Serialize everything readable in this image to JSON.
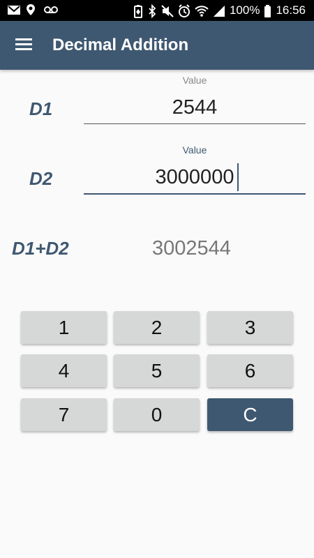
{
  "status_bar": {
    "battery_percent": "100%",
    "time": "16:56",
    "left_icons": [
      "gmail-icon",
      "location-icon",
      "voicemail-icon"
    ],
    "right_icons": [
      "battery-saver-icon",
      "bluetooth-icon",
      "mute-icon",
      "alarm-icon",
      "wifi-icon",
      "signal-icon",
      "battery-icon"
    ]
  },
  "app_bar": {
    "title": "Decimal Addition",
    "color": "#3f5871"
  },
  "form": {
    "d1": {
      "label": "D1",
      "field_label": "Value",
      "value": "2544"
    },
    "d2": {
      "label": "D2",
      "field_label": "Value",
      "value": "3000000"
    },
    "sum": {
      "label": "D1+D2",
      "value": "3002544"
    }
  },
  "keypad": {
    "k1": "1",
    "k2": "2",
    "k3": "3",
    "k4": "4",
    "k5": "5",
    "k6": "6",
    "k7": "7",
    "k0": "0",
    "clear": "C"
  },
  "colors": {
    "accent": "#3f5871",
    "key_bg": "#d6d7d7",
    "background": "#fafafa"
  }
}
